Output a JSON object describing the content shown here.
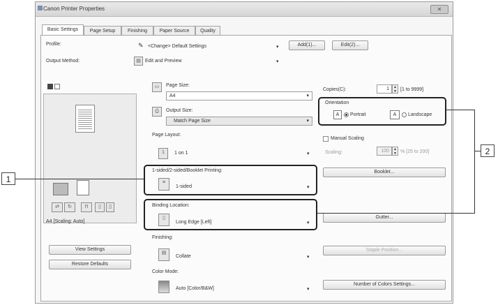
{
  "window": {
    "title": "Canon Printer Properties",
    "close": "✕"
  },
  "tabs": [
    "Basic Settings",
    "Page Setup",
    "Finishing",
    "Paper Source",
    "Quality"
  ],
  "profile": {
    "label": "Profile:",
    "value": "<Change> Default Settings",
    "add": "Add(1)...",
    "edit": "Edit(2)..."
  },
  "output_method": {
    "label": "Output Method:",
    "value": "Edit and Preview"
  },
  "preview": {
    "status": "A4 [Scaling: Auto]"
  },
  "left_buttons": {
    "view_settings": "View Settings",
    "restore_defaults": "Restore Defaults"
  },
  "page_size": {
    "label": "Page Size:",
    "value": "A4"
  },
  "output_size": {
    "label": "Output Size:",
    "value": "Match Page Size"
  },
  "page_layout": {
    "label": "Page Layout:",
    "value": "1 on 1"
  },
  "duplex": {
    "label": "1-sided/2-sided/Booklet Printing:",
    "value": "1-sided"
  },
  "binding": {
    "label": "Binding Location:",
    "value": "Long Edge [Left]"
  },
  "finishing": {
    "label": "Finishing:",
    "value": "Collate"
  },
  "color_mode": {
    "label": "Color Mode:",
    "value": "Auto [Color/B&W]"
  },
  "copies": {
    "label": "Copies(C):",
    "value": "1",
    "range": "[1 to 9999]"
  },
  "orientation": {
    "label": "Orientation",
    "portrait": "Portrait",
    "landscape": "Landscape",
    "selected": "portrait"
  },
  "manual_scaling": {
    "label": "Manual Scaling",
    "scaling_label": "Scaling:",
    "value": "100",
    "range": "% [25 to 200]"
  },
  "right_buttons": {
    "booklet": "Booklet...",
    "gutter": "Gutter...",
    "staple_position": "Staple Position...",
    "number_of_colors": "Number of Colors Settings..."
  },
  "callouts": [
    "1",
    "2"
  ]
}
